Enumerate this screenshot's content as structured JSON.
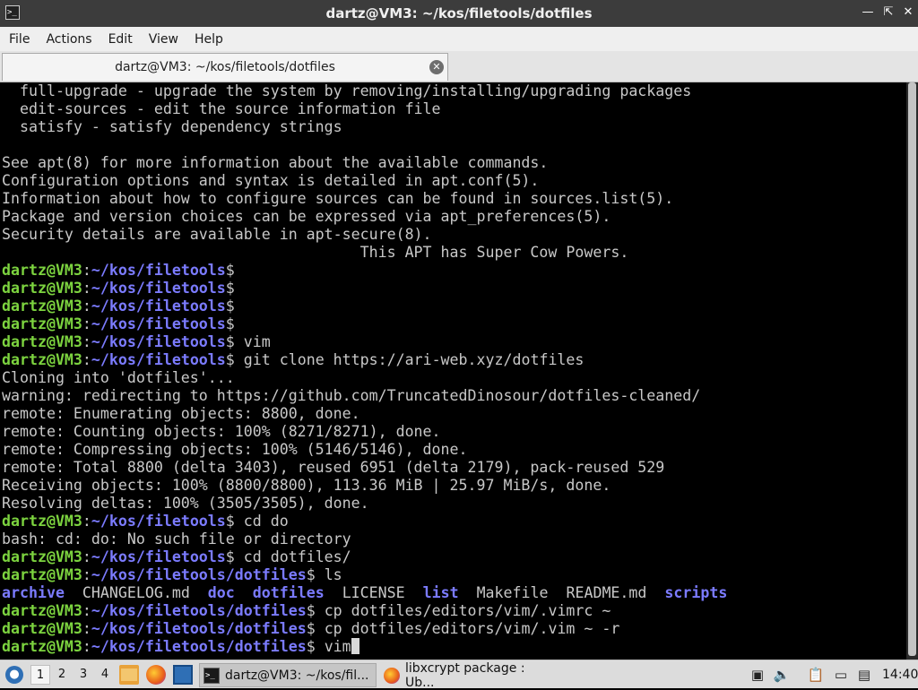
{
  "window": {
    "title": "dartz@VM3: ~/kos/filetools/dotfiles",
    "app_icon_text": ">_"
  },
  "menu": [
    "File",
    "Actions",
    "Edit",
    "View",
    "Help"
  ],
  "tab": {
    "label": "dartz@VM3: ~/kos/filetools/dotfiles"
  },
  "terminal": {
    "output_top": [
      "  full-upgrade - upgrade the system by removing/installing/upgrading packages",
      "  edit-sources - edit the source information file",
      "  satisfy - satisfy dependency strings",
      "",
      "See apt(8) for more information about the available commands.",
      "Configuration options and syntax is detailed in apt.conf(5).",
      "Information about how to configure sources can be found in sources.list(5).",
      "Package and version choices can be expressed via apt_preferences(5).",
      "Security details are available in apt-secure(8).",
      "                                        This APT has Super Cow Powers."
    ],
    "prompt_user": "dartz@VM3",
    "lines": [
      {
        "kind": "prompt",
        "path": "~/kos/filetools",
        "cmd": ""
      },
      {
        "kind": "prompt",
        "path": "~/kos/filetools",
        "cmd": ""
      },
      {
        "kind": "prompt",
        "path": "~/kos/filetools",
        "cmd": ""
      },
      {
        "kind": "prompt",
        "path": "~/kos/filetools",
        "cmd": ""
      },
      {
        "kind": "prompt",
        "path": "~/kos/filetools",
        "cmd": " vim"
      },
      {
        "kind": "prompt",
        "path": "~/kos/filetools",
        "cmd": " git clone https://ari-web.xyz/dotfiles"
      },
      {
        "kind": "out",
        "text": "Cloning into 'dotfiles'..."
      },
      {
        "kind": "out",
        "text": "warning: redirecting to https://github.com/TruncatedDinosour/dotfiles-cleaned/"
      },
      {
        "kind": "out",
        "text": "remote: Enumerating objects: 8800, done."
      },
      {
        "kind": "out",
        "text": "remote: Counting objects: 100% (8271/8271), done."
      },
      {
        "kind": "out",
        "text": "remote: Compressing objects: 100% (5146/5146), done."
      },
      {
        "kind": "out",
        "text": "remote: Total 8800 (delta 3403), reused 6951 (delta 2179), pack-reused 529"
      },
      {
        "kind": "out",
        "text": "Receiving objects: 100% (8800/8800), 113.36 MiB | 25.97 MiB/s, done."
      },
      {
        "kind": "out",
        "text": "Resolving deltas: 100% (3505/3505), done."
      },
      {
        "kind": "prompt",
        "path": "~/kos/filetools",
        "cmd": " cd do"
      },
      {
        "kind": "out",
        "text": "bash: cd: do: No such file or directory"
      },
      {
        "kind": "prompt",
        "path": "~/kos/filetools",
        "cmd": " cd dotfiles/"
      },
      {
        "kind": "prompt",
        "path": "~/kos/filetools/dotfiles",
        "cmd": " ls"
      },
      {
        "kind": "ls"
      },
      {
        "kind": "prompt",
        "path": "~/kos/filetools/dotfiles",
        "cmd": " cp dotfiles/editors/vim/.vimrc ~"
      },
      {
        "kind": "prompt",
        "path": "~/kos/filetools/dotfiles",
        "cmd": " cp dotfiles/editors/vim/.vim ~ -r"
      },
      {
        "kind": "prompt",
        "path": "~/kos/filetools/dotfiles",
        "cmd": " vim",
        "cursor": true
      }
    ],
    "ls_entries": [
      {
        "name": "archive",
        "type": "dir"
      },
      {
        "name": "CHANGELOG.md",
        "type": "file"
      },
      {
        "name": "doc",
        "type": "dir"
      },
      {
        "name": "dotfiles",
        "type": "dir"
      },
      {
        "name": "LICENSE",
        "type": "file"
      },
      {
        "name": "list",
        "type": "dir"
      },
      {
        "name": "Makefile",
        "type": "file"
      },
      {
        "name": "README.md",
        "type": "file"
      },
      {
        "name": "scripts",
        "type": "dir"
      }
    ]
  },
  "taskbar": {
    "workspaces": [
      "1",
      "2",
      "3",
      "4"
    ],
    "tasks": [
      {
        "label": "dartz@VM3: ~/kos/fil...",
        "icon": "terminal-icon",
        "active": true
      },
      {
        "label": "libxcrypt package : Ub...",
        "icon": "firefox-icon",
        "active": false
      }
    ],
    "clock": "14:40"
  },
  "colors": {
    "prompt_user": "#7cd33f",
    "prompt_path": "#7b7bff",
    "terminal_bg": "#000000",
    "terminal_fg": "#c8c8c8"
  }
}
